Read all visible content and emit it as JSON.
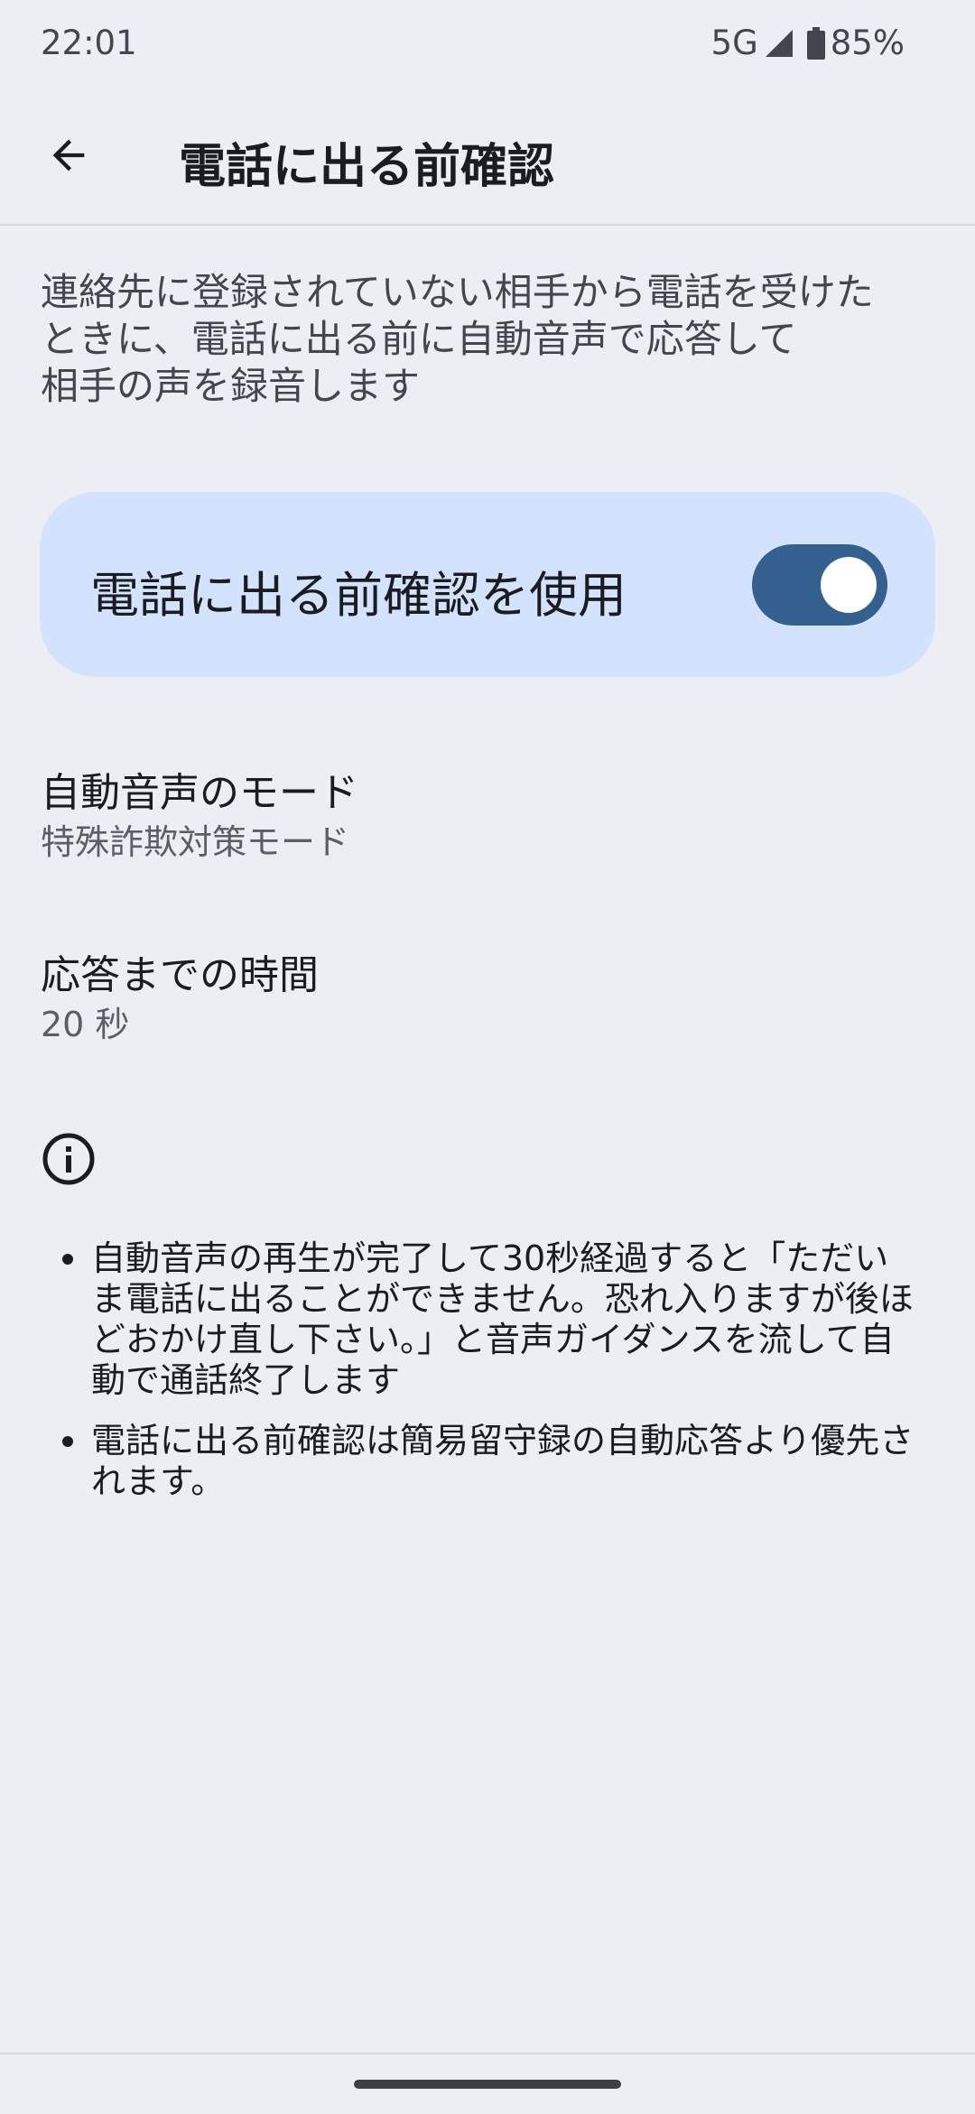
{
  "status_bar": {
    "time": "22:01",
    "network": "5G",
    "battery_percent": "85%"
  },
  "app_bar": {
    "title": "電話に出る前確認"
  },
  "description_lines": [
    "連絡先に登録されていない相手から電話を受けた",
    "ときに、電話に出る前に自動音声で応答して",
    "相手の声を録音します"
  ],
  "main_toggle": {
    "label": "電話に出る前確認を使用",
    "enabled": true
  },
  "settings": [
    {
      "title": "自動音声のモード",
      "value": "特殊詐欺対策モード"
    },
    {
      "title": "応答までの時間",
      "value": "20 秒"
    }
  ],
  "notes": [
    {
      "lines": [
        "自動音声の再生が完了して30秒経過すると「ただい",
        "ま電話に出ることができません。恐れ入りますが後ほ",
        "どおかけ直し下さい。」と音声ガイダンスを流して自",
        "動で通話終了します"
      ]
    },
    {
      "lines": [
        "電話に出る前確認は簡易留守録の自動応答より優先さ",
        "れます。"
      ]
    }
  ],
  "icons": {
    "back": "arrow-back-icon",
    "info": "info-icon",
    "signal": "signal-icon",
    "battery": "battery-icon"
  },
  "colors": {
    "background": "#eceef4",
    "toggle_card": "#d4e3fd",
    "toggle_track": "#34608f",
    "toggle_knob": "#ffffff"
  }
}
